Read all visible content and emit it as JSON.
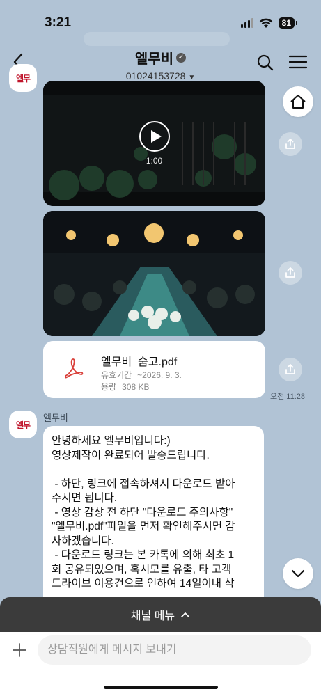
{
  "status_bar": {
    "time": "3:21",
    "battery": "81"
  },
  "header": {
    "title": "엘무비",
    "subtitle": "01024153728"
  },
  "video_card": {
    "duration": "1:00"
  },
  "file_card": {
    "name": "엘무비_숨고.pdf",
    "validity_label": "유효기간",
    "validity_value": "~2026. 9. 3.",
    "size_label": "용량",
    "size_value": "308 KB"
  },
  "message_time": "오전 11:28",
  "message": {
    "sender": "엘무비",
    "text": "안녕하세요 엘무비입니다:)\n영상제작이 완료되어 발송드립니다.\n\n - 하단, 링크에 접속하셔서 다운로드 받아\n주시면 됩니다.\n - 영상 감상 전 하단 \"다운로드 주의사항\"\n\"엘무비.pdf\"파일을 먼저 확인해주시면 감\n사하겠습니다.\n - 다운로드 링크는 본 카톡에 의해 최초 1\n회 공유되었으며, 혹시모를 유출, 타 고객\n드라이브 이용건으로 인하여 14일이내 삭"
  },
  "channel_menu": {
    "label": "채널 메뉴"
  },
  "input": {
    "placeholder": "상담직원에게 메시지 보내기"
  },
  "icons": {
    "back": "chevron-left-icon",
    "search": "search-icon",
    "menu": "hamburger-icon",
    "home": "home-icon",
    "share": "share-icon",
    "play": "play-icon",
    "pdf": "pdf-icon",
    "scroll_down": "chevron-down-icon",
    "plus": "plus-icon"
  }
}
